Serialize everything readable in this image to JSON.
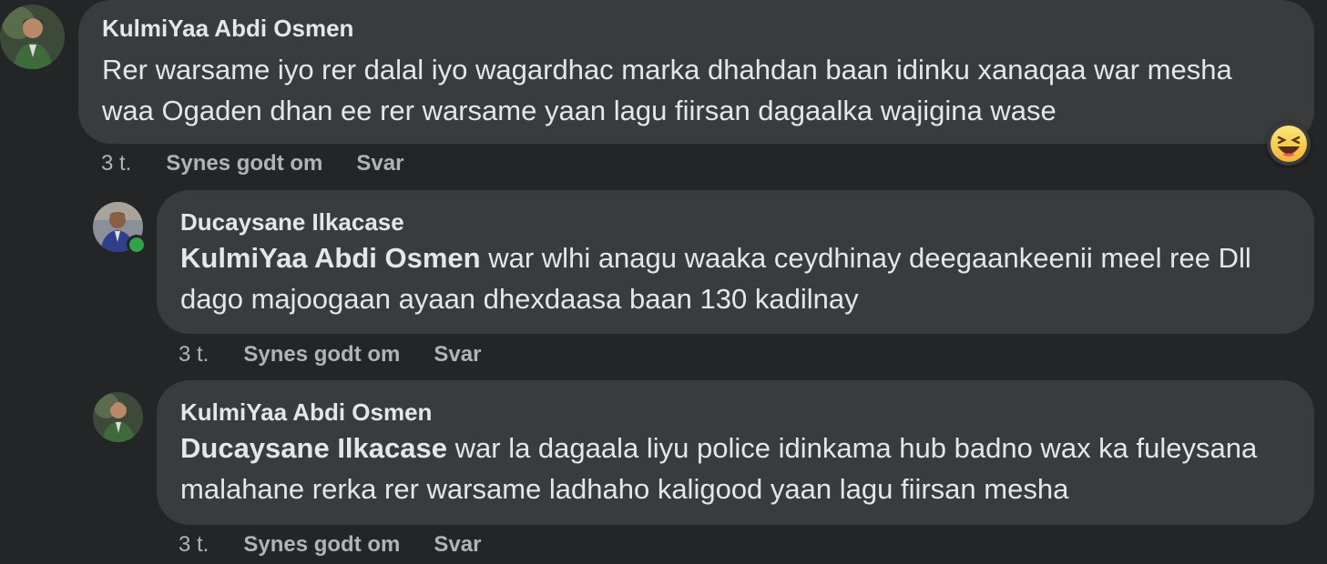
{
  "comments": [
    {
      "author": "KulmiYaa Abdi Osmen",
      "mention": "",
      "text": "Rer warsame iyo rer dalal iyo wagardhac marka dhahdan baan idinku xanaqaa war mesha waa Ogaden dhan ee rer warsame yaan lagu fiirsan dagaalka wajigina wase",
      "time": "3 t.",
      "like_label": "Synes godt om",
      "reply_label": "Svar",
      "reaction_icon": "laughing-emoji-icon"
    },
    {
      "author": "Ducaysane Ilkacase",
      "mention": "KulmiYaa Abdi Osmen",
      "text": "war wlhi anagu waaka ceydhinay deegaankeenii meel ree Dll dago majoogaan ayaan dhexdaasa baan 130 kadilnay",
      "time": "3 t.",
      "like_label": "Synes godt om",
      "reply_label": "Svar",
      "online": true
    },
    {
      "author": "KulmiYaa Abdi Osmen",
      "mention": "Ducaysane Ilkacase",
      "text": "war la dagaala liyu police idinkama hub badno wax ka fuleysana malahane rerka rer warsame ladhaho kaligood yaan lagu fiirsan mesha",
      "time": "3 t.",
      "like_label": "Synes godt om",
      "reply_label": "Svar"
    }
  ],
  "colors": {
    "background": "#242526",
    "bubble": "#3a3b3c",
    "text": "#e4e6eb",
    "secondary": "#b0b3b8",
    "online": "#31a24c"
  }
}
